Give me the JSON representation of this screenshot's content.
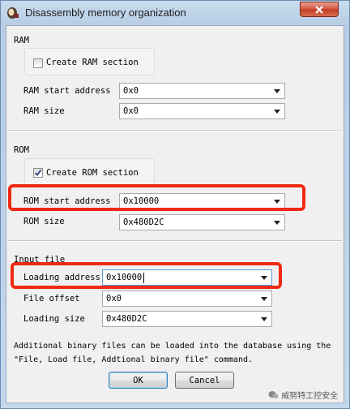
{
  "window": {
    "title": "Disassembly memory organization",
    "close_icon": "close-icon"
  },
  "ram": {
    "section_label": "RAM",
    "create_label": "Create RAM section",
    "create_checked": false,
    "start_label": "RAM start address",
    "start_value": "0x0",
    "size_label": "RAM size",
    "size_value": "0x0"
  },
  "rom": {
    "section_label": "ROM",
    "create_label": "Create ROM section",
    "create_checked": true,
    "start_label": "ROM start address",
    "start_value": "0x10000",
    "size_label": "ROM size",
    "size_value": "0x480D2C"
  },
  "input_file": {
    "section_label": "Input file",
    "loading_label": "Loading address",
    "loading_value": "0x10000",
    "offset_label": "File offset",
    "offset_value": "0x0",
    "size_label": "Loading size",
    "size_value": "0x480D2C"
  },
  "note": {
    "line1": "Additional binary files can be loaded into the database using the",
    "line2": "\"File, Load file, Addtional binary file\" command."
  },
  "buttons": {
    "ok": "OK",
    "cancel": "Cancel"
  },
  "watermark": "威努特工控安全",
  "colors": {
    "highlight": "#ef2a14"
  }
}
